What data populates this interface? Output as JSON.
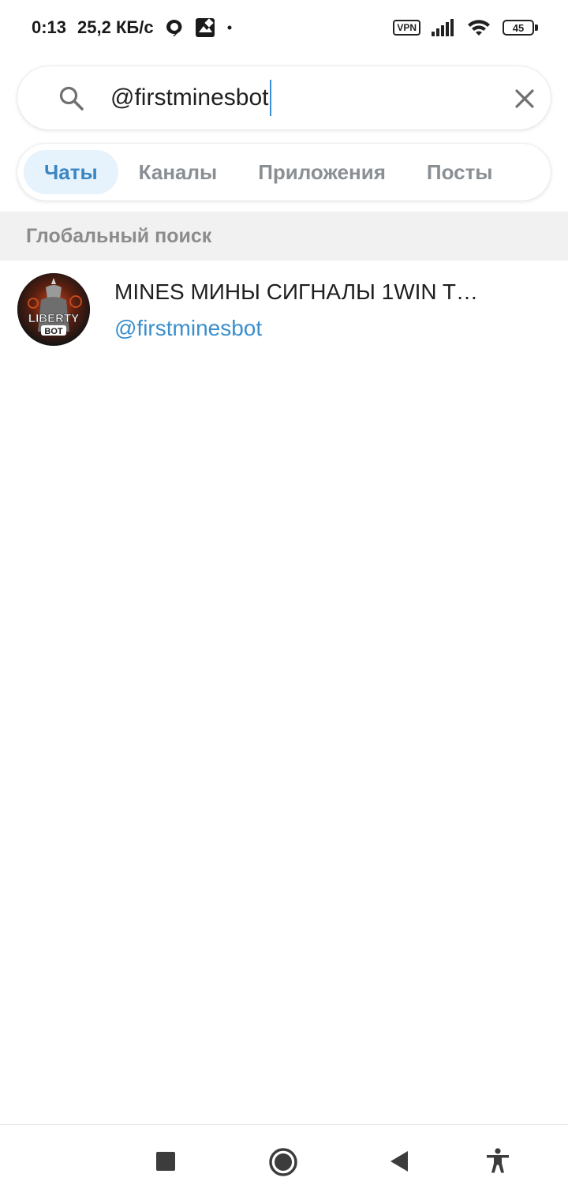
{
  "status_bar": {
    "time": "0:13",
    "speed": "25,2 КБ/с",
    "vpn": "VPN",
    "battery": "45",
    "icons": [
      "chat-bubble-icon",
      "image-notification-icon",
      "dot-icon",
      "signal-icon",
      "wifi-icon",
      "battery-icon"
    ]
  },
  "search": {
    "value": "@firstminesbot",
    "icons": {
      "left": "search-icon",
      "right": "close-icon"
    }
  },
  "tabs": [
    {
      "label": "Чаты",
      "active": true
    },
    {
      "label": "Каналы",
      "active": false
    },
    {
      "label": "Приложения",
      "active": false
    },
    {
      "label": "Посты",
      "active": false
    }
  ],
  "section": {
    "title": "Глобальный поиск"
  },
  "results": [
    {
      "title": "MINES МИНЫ СИГНАЛЫ 1WIN T…",
      "username": "@firstminesbot",
      "avatar_text": [
        "LIBERTY",
        "BOT"
      ]
    }
  ],
  "nav_bar": {
    "icons": [
      "recent-apps-icon",
      "home-icon",
      "back-icon",
      "accessibility-icon"
    ]
  },
  "colors": {
    "accent": "#3a87c4",
    "tab_active_bg": "#e6f2fc",
    "username": "#3a8fcc",
    "section_bg": "#f1f1f1"
  }
}
